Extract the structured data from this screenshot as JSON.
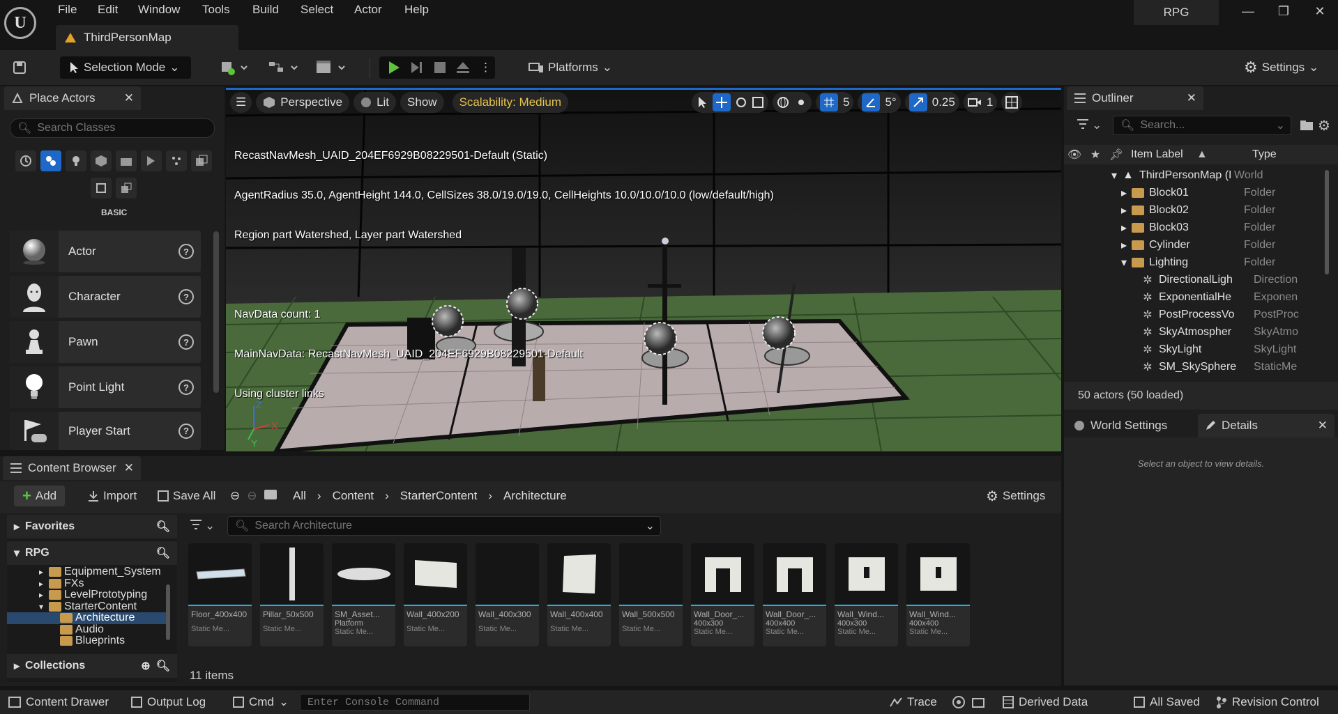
{
  "menubar": {
    "items": [
      "File",
      "Edit",
      "Window",
      "Tools",
      "Build",
      "Select",
      "Actor",
      "Help"
    ],
    "project": "RPG",
    "map_tab": "ThirdPersonMap"
  },
  "toolbar": {
    "mode": "Selection Mode",
    "platforms": "Platforms",
    "settings": "Settings"
  },
  "place_actors": {
    "title": "Place Actors",
    "search_placeholder": "Search Classes",
    "category": "BASIC",
    "items": [
      {
        "label": "Actor",
        "icon": "sphere-icon"
      },
      {
        "label": "Character",
        "icon": "character-icon"
      },
      {
        "label": "Pawn",
        "icon": "pawn-icon"
      },
      {
        "label": "Point Light",
        "icon": "lightbulb-icon"
      },
      {
        "label": "Player Start",
        "icon": "flag-gamepad-icon"
      }
    ]
  },
  "viewport": {
    "perspective": "Perspective",
    "lit": "Lit",
    "show": "Show",
    "scalability": "Scalability: Medium",
    "grid_snap": "5",
    "rot_snap": "5°",
    "scale_snap": "0.25",
    "cam_speed": "1",
    "overlay": [
      "RecastNavMesh_UAID_204EF6929B08229501-Default (Static)",
      "AgentRadius 35.0, AgentHeight 144.0, CellSizes 38.0/19.0/19.0, CellHeights 10.0/10.0/10.0 (low/default/high)",
      "Region part Watershed, Layer part Watershed",
      "",
      "NavData count: 1",
      "MainNavData: RecastNavMesh_UAID_204EF6929B08229501-Default",
      "Using cluster links"
    ]
  },
  "outliner": {
    "title": "Outliner",
    "search_placeholder": "Search...",
    "col_label": "Item Label",
    "col_type": "Type",
    "rows": [
      {
        "label": "ThirdPersonMap (I",
        "type": "World",
        "indent": 0,
        "kind": "world",
        "expand": "open"
      },
      {
        "label": "Block01",
        "type": "Folder",
        "indent": 1,
        "kind": "folder",
        "expand": "closed"
      },
      {
        "label": "Block02",
        "type": "Folder",
        "indent": 1,
        "kind": "folder",
        "expand": "closed"
      },
      {
        "label": "Block03",
        "type": "Folder",
        "indent": 1,
        "kind": "folder",
        "expand": "closed"
      },
      {
        "label": "Cylinder",
        "type": "Folder",
        "indent": 1,
        "kind": "folder",
        "expand": "closed"
      },
      {
        "label": "Lighting",
        "type": "Folder",
        "indent": 1,
        "kind": "folder",
        "expand": "open"
      },
      {
        "label": "DirectionalLigh",
        "type": "Direction",
        "indent": 2,
        "kind": "actor",
        "expand": ""
      },
      {
        "label": "ExponentialHe",
        "type": "Exponen",
        "indent": 2,
        "kind": "actor",
        "expand": ""
      },
      {
        "label": "PostProcessVo",
        "type": "PostProc",
        "indent": 2,
        "kind": "actor",
        "expand": ""
      },
      {
        "label": "SkyAtmospher",
        "type": "SkyAtmo",
        "indent": 2,
        "kind": "actor",
        "expand": ""
      },
      {
        "label": "SkyLight",
        "type": "SkyLight",
        "indent": 2,
        "kind": "actor",
        "expand": ""
      },
      {
        "label": "SM_SkySphere",
        "type": "StaticMe",
        "indent": 2,
        "kind": "actor",
        "expand": ""
      }
    ],
    "count": "50 actors (50 loaded)"
  },
  "details": {
    "world_settings": "World Settings",
    "title": "Details",
    "empty": "Select an object to view details."
  },
  "content_browser": {
    "title": "Content Browser",
    "add": "Add",
    "import": "Import",
    "save_all": "Save All",
    "settings": "Settings",
    "path": [
      "All",
      "Content",
      "StarterContent",
      "Architecture"
    ],
    "favorites": "Favorites",
    "rpg": "RPG",
    "collections": "Collections",
    "tree": [
      {
        "label": "Equipment_System",
        "indent": 1
      },
      {
        "label": "FXs",
        "indent": 1
      },
      {
        "label": "LevelPrototyping",
        "indent": 1
      },
      {
        "label": "StarterContent",
        "indent": 1
      },
      {
        "label": "Architecture",
        "indent": 2
      },
      {
        "label": "Audio",
        "indent": 2
      },
      {
        "label": "Blueprints",
        "indent": 2
      }
    ],
    "search_placeholder": "Search Architecture",
    "assets": [
      {
        "name": "Floor_400x400",
        "sub": "",
        "type": "Static Me...",
        "shape": "floor"
      },
      {
        "name": "Pillar_50x500",
        "sub": "",
        "type": "Static Me...",
        "shape": "pillar"
      },
      {
        "name": "SM_Asset...",
        "sub": "Platform",
        "type": "Static Me...",
        "shape": "disc"
      },
      {
        "name": "Wall_400x200",
        "sub": "",
        "type": "Static Me...",
        "shape": "wallwide"
      },
      {
        "name": "Wall_400x300",
        "sub": "",
        "type": "Static Me...",
        "shape": "none"
      },
      {
        "name": "Wall_400x400",
        "sub": "",
        "type": "Static Me...",
        "shape": "wallsq"
      },
      {
        "name": "Wall_500x500",
        "sub": "",
        "type": "Static Me...",
        "shape": "none"
      },
      {
        "name": "Wall_Door_...",
        "sub": "400x300",
        "type": "Static Me...",
        "shape": "door"
      },
      {
        "name": "Wall_Door_...",
        "sub": "400x400",
        "type": "Static Me...",
        "shape": "door"
      },
      {
        "name": "Wall_Wind...",
        "sub": "400x300",
        "type": "Static Me...",
        "shape": "window"
      },
      {
        "name": "Wall_Wind...",
        "sub": "400x400",
        "type": "Static Me...",
        "shape": "window"
      }
    ],
    "count": "11 items"
  },
  "statusbar": {
    "content_drawer": "Content Drawer",
    "output_log": "Output Log",
    "cmd": "Cmd",
    "console_placeholder": "Enter Console Command",
    "trace": "Trace",
    "derived_data": "Derived Data",
    "all_saved": "All Saved",
    "revision_control": "Revision Control"
  },
  "colors": {
    "accent": "#1e69c7",
    "play": "#5ec43b",
    "scalability": "#e5c44a",
    "selection": "#294a6e"
  }
}
